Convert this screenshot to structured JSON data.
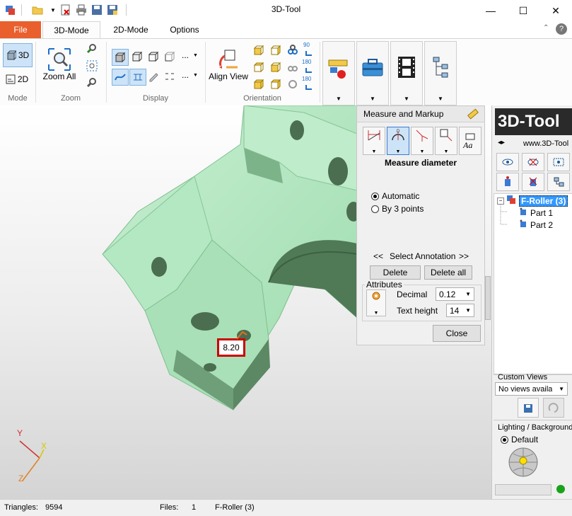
{
  "window": {
    "title": "3D-Tool",
    "minimize": "—",
    "maximize": "☐",
    "close": "✕"
  },
  "quick_access": [
    "app-icon",
    "open-folder-icon",
    "close-file-icon",
    "print-icon",
    "save-icon",
    "save-copy-icon"
  ],
  "tabs": [
    {
      "label": "File"
    },
    {
      "label": "3D-Mode"
    },
    {
      "label": "2D-Mode"
    },
    {
      "label": "Options"
    }
  ],
  "ribbon": {
    "mode": {
      "label": "Mode",
      "btn3d": "3D",
      "btn2d": "2D"
    },
    "zoom": {
      "label": "Zoom",
      "zoom_all": "Zoom All"
    },
    "display": {
      "label": "Display",
      "more": "..."
    },
    "orientation": {
      "label": "Orientation",
      "align_view": "Align View",
      "rot90": "90",
      "rot180a": "180",
      "rot180b": "180"
    }
  },
  "viewport": {
    "measurement_value": "8.20",
    "axis_x": "X",
    "axis_y": "Y",
    "axis_z": "Z"
  },
  "measure_panel": {
    "title": "Measure and Markup",
    "tool_title": "Measure diameter",
    "radio_automatic": "Automatic",
    "radio_by3": "By 3 points",
    "select_prev": "<<",
    "select_label": "Select Annotation",
    "select_next": ">>",
    "delete": "Delete",
    "delete_all": "Delete all",
    "attributes": "Attributes",
    "decimal_label": "Decimal",
    "decimal_value": "0.12",
    "text_height_label": "Text height",
    "text_height_value": "14",
    "close": "Close"
  },
  "right_panel": {
    "logo": "3D-Tool",
    "url": "www.3D-Tool",
    "tree_root": "F-Roller (3)",
    "tree_children": [
      "Part 1",
      "Part 2"
    ],
    "custom_views": "Custom Views",
    "custom_views_value": "No views availa",
    "lighting": "Lighting / Background",
    "lighting_default": "Default"
  },
  "status": {
    "triangles_label": "Triangles:",
    "triangles_value": "9594",
    "files_label": "Files:",
    "files_value": "1",
    "filename": "F-Roller (3)"
  },
  "colors": {
    "accent": "#e95f2d",
    "model": "#a6e2b6",
    "highlight": "#cc0000"
  }
}
